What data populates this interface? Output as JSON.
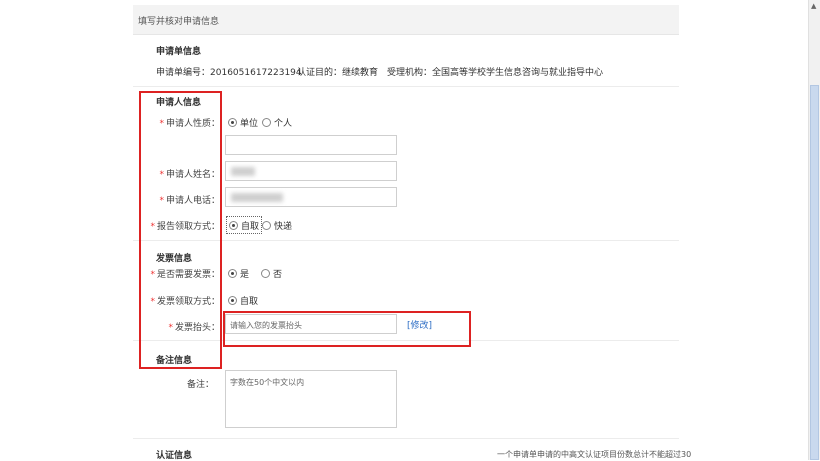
{
  "header": {
    "title": "填写并核对申请信息"
  },
  "application": {
    "section_title": "申请单信息",
    "number_label": "申请单编号：",
    "number_value": "2016051617223194",
    "purpose_label": "认证目的：",
    "purpose_value": "继续教育",
    "agency_label": "受理机构：",
    "agency_value": "全国高等学校学生信息咨询与就业指导中心"
  },
  "applicant": {
    "section_title": "申请人信息",
    "nature_label": "申请人性质：",
    "nature_options": [
      "单位",
      "个人"
    ],
    "name_label": "申请人姓名：",
    "phone_label": "申请人电话：",
    "report_label": "报告领取方式：",
    "report_options": [
      "自取",
      "快递"
    ]
  },
  "invoice": {
    "section_title": "发票信息",
    "need_label": "是否需要发票：",
    "need_options": [
      "是",
      "否"
    ],
    "receive_label": "发票领取方式：",
    "receive_option": "自取",
    "title_label": "发票抬头：",
    "title_placeholder": "请输入您的发票抬头",
    "modify_link": "[修改]"
  },
  "remarks": {
    "section_title": "备注信息",
    "label": "备注：",
    "placeholder": "字数在50个中文以内"
  },
  "certification": {
    "section_title": "认证信息",
    "note": "一个申请单申请的中高文认证项目份数总计不能超过30"
  },
  "colors": {
    "highlight": "#d22222",
    "link": "#2b6cc4"
  }
}
